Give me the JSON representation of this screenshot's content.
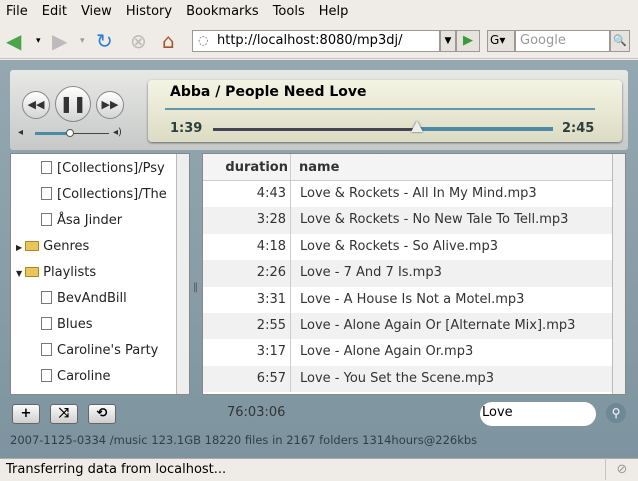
{
  "menu": [
    "File",
    "Edit",
    "View",
    "History",
    "Bookmarks",
    "Tools",
    "Help"
  ],
  "toolbar": {
    "url": "http://localhost:8080/mp3dj/",
    "search_placeholder": "Google",
    "engine": "G"
  },
  "player": {
    "now_playing": "Abba / People Need Love",
    "elapsed": "1:39",
    "total": "2:45",
    "progress": 0.6,
    "volume": 0.5
  },
  "tree": [
    {
      "label": "[Collections]/Psy",
      "type": "file",
      "level": 2
    },
    {
      "label": "[Collections]/The",
      "type": "file",
      "level": 2
    },
    {
      "label": "Åsa Jinder",
      "type": "file",
      "level": 2
    },
    {
      "label": "Genres",
      "type": "folder",
      "level": 1,
      "expanded": false
    },
    {
      "label": "Playlists",
      "type": "folder",
      "level": 1,
      "expanded": true
    },
    {
      "label": "BevAndBill",
      "type": "file",
      "level": 2
    },
    {
      "label": "Blues",
      "type": "file",
      "level": 2
    },
    {
      "label": "Caroline's Party",
      "type": "file",
      "level": 2
    },
    {
      "label": "Caroline",
      "type": "file",
      "level": 2
    }
  ],
  "table": {
    "headers": [
      "duration",
      "name"
    ],
    "rows": [
      {
        "duration": "4:43",
        "name": "Love & Rockets - All In My Mind.mp3"
      },
      {
        "duration": "3:28",
        "name": "Love & Rockets - No New Tale To Tell.mp3"
      },
      {
        "duration": "4:18",
        "name": "Love & Rockets - So Alive.mp3"
      },
      {
        "duration": "2:26",
        "name": "Love - 7 And 7 Is.mp3"
      },
      {
        "duration": "3:31",
        "name": "Love - A House Is Not a Motel.mp3"
      },
      {
        "duration": "2:55",
        "name": "Love - Alone Again Or [Alternate Mix].mp3"
      },
      {
        "duration": "3:17",
        "name": "Love - Alone Again Or.mp3"
      },
      {
        "duration": "6:57",
        "name": "Love - You Set the Scene.mp3"
      }
    ]
  },
  "bottom": {
    "total_time": "76:03:06",
    "search_value": "Love",
    "stats": "2007-1125-0334 /music 123.1GB  18220 files in 2167 folders  1314hours@226kbs"
  },
  "status": "Transferring data from localhost..."
}
